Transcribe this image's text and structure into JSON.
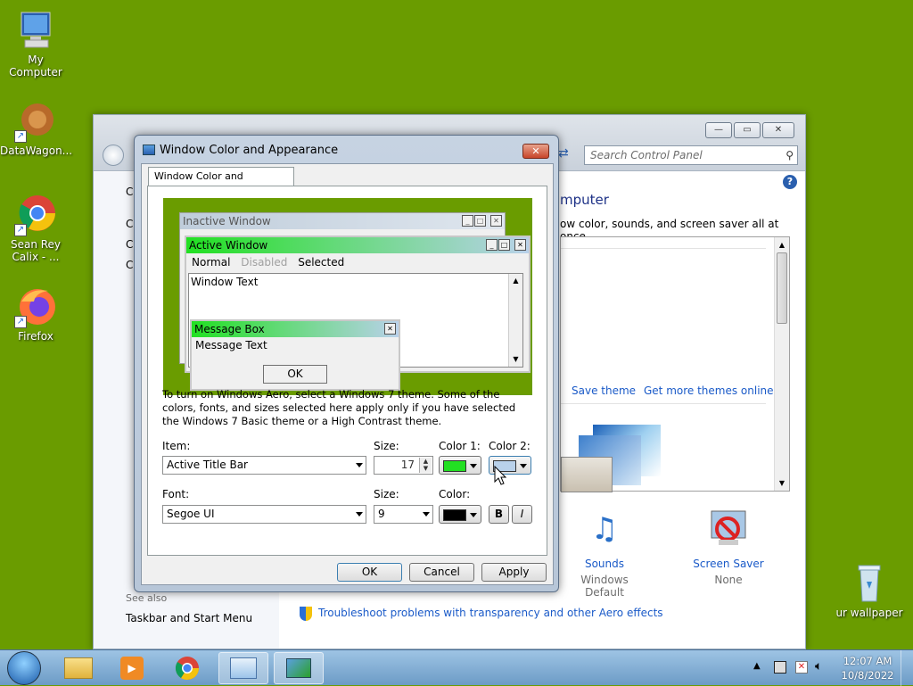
{
  "desktop": {
    "icons": [
      {
        "label": "My Computer"
      },
      {
        "label": "DataWagon..."
      },
      {
        "label": "Sean Rey Calix - ..."
      },
      {
        "label": "Firefox"
      },
      {
        "label": "ur wallpaper"
      }
    ]
  },
  "control_panel": {
    "search_placeholder": "Search Control Panel",
    "heading_fragment": "mputer",
    "description_fragment": "ow color, sounds, and screen saver all at once.",
    "left_letters": [
      "C",
      "C",
      "C",
      "C"
    ],
    "save_theme": "Save theme",
    "get_more_themes": "Get more themes online",
    "sounds_label": "Sounds",
    "sounds_value": "Windows Default",
    "screensaver_label": "Screen Saver",
    "screensaver_value": "None",
    "see_also": "See also",
    "taskbar_link": "Taskbar and Start Menu",
    "troubleshoot_link": "Troubleshoot problems with transparency and other Aero effects"
  },
  "dialog": {
    "title": "Window Color and Appearance",
    "tab_label": "Window Color and Appearance",
    "preview": {
      "inactive_title": "Inactive Window",
      "active_title": "Active Window",
      "menu_normal": "Normal",
      "menu_disabled": "Disabled",
      "menu_selected": "Selected",
      "window_text": "Window Text",
      "msgbox_title": "Message Box",
      "msgbox_text": "Message Text",
      "msgbox_ok": "OK"
    },
    "info_text": "To turn on Windows Aero, select a Windows 7 theme.  Some of the colors, fonts, and sizes selected here apply only if you have selected the Windows 7 Basic theme or a High Contrast theme.",
    "item_label": "Item:",
    "item_value": "Active Title Bar",
    "size_label": "Size:",
    "size_value": "17",
    "color1_label": "Color 1:",
    "color2_label": "Color 2:",
    "font_label": "Font:",
    "font_value": "Segoe UI",
    "font_size_label": "Size:",
    "font_size_value": "9",
    "font_color_label": "Color:",
    "bold_label": "B",
    "italic_label": "I",
    "ok_label": "OK",
    "cancel_label": "Cancel",
    "apply_label": "Apply",
    "colors": {
      "color1": "#22e022",
      "color2": "#b9d1ea",
      "font_color": "#000000",
      "preview_bg": "#6a9c00"
    }
  },
  "taskbar": {
    "time": "12:07 AM",
    "date": "10/8/2022"
  }
}
